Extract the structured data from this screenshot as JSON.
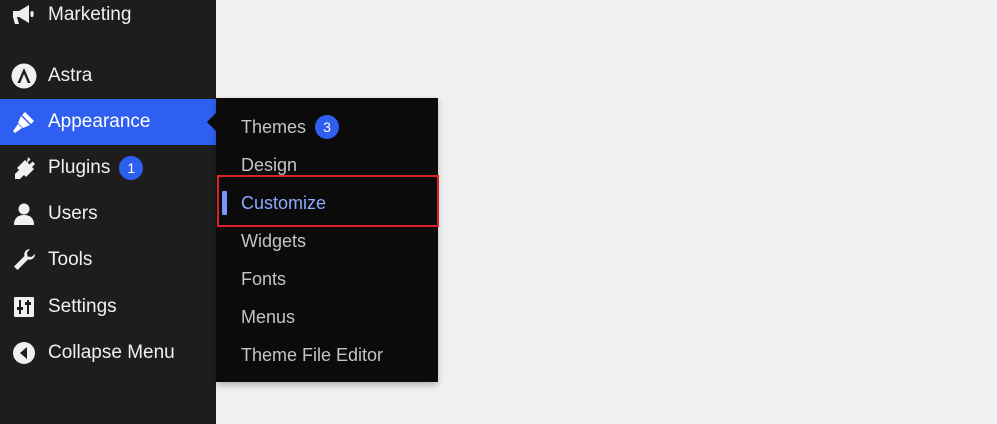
{
  "sidebar": {
    "items": [
      {
        "label": "Marketing",
        "icon": "megaphone-icon"
      },
      {
        "label": "Astra",
        "icon": "astra-logo-icon"
      },
      {
        "label": "Appearance",
        "icon": "paintbrush-icon",
        "active": true
      },
      {
        "label": "Plugins",
        "icon": "plug-icon",
        "badge": "1"
      },
      {
        "label": "Users",
        "icon": "user-icon"
      },
      {
        "label": "Tools",
        "icon": "wrench-icon"
      },
      {
        "label": "Settings",
        "icon": "sliders-icon"
      },
      {
        "label": "Collapse Menu",
        "icon": "collapse-arrow-icon"
      }
    ]
  },
  "submenu": {
    "items": [
      {
        "label": "Themes",
        "badge": "3"
      },
      {
        "label": "Design"
      },
      {
        "label": "Customize",
        "current": true
      },
      {
        "label": "Widgets"
      },
      {
        "label": "Fonts"
      },
      {
        "label": "Menus"
      },
      {
        "label": "Theme File Editor"
      }
    ]
  },
  "colors": {
    "sidebar_bg": "#1d1d1d",
    "submenu_bg": "#0b0b0b",
    "accent": "#2f5ff0",
    "current_text": "#8ea8ff",
    "highlight": "#d8232a",
    "page_bg": "#f0f0f1"
  }
}
